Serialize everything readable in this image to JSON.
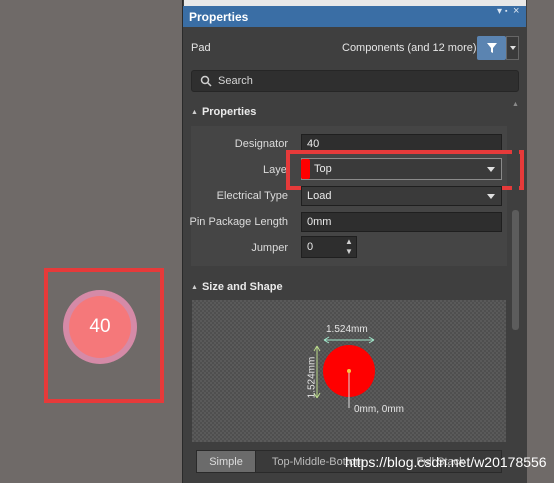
{
  "canvas": {
    "pad_number": "40",
    "pad_outer_color": "#d58aa7",
    "pad_inner_color": "#f5787a",
    "highlight_color": "#e63a3a"
  },
  "panel": {
    "title": "Properties",
    "title_buttons": [
      "▾",
      "▪",
      "×"
    ],
    "accent_color": "#3a6ea5",
    "object_type": "Pad",
    "filter_text": "Components (and 12 more)",
    "filter_icon": "funnel-icon",
    "search": {
      "placeholder": "Search",
      "icon": "search-icon"
    }
  },
  "properties_section": {
    "title": "Properties",
    "rows": [
      {
        "label": "Designator",
        "value": "40"
      },
      {
        "label": "Layer",
        "value": "Top",
        "swatch_color": "#ff0000"
      },
      {
        "label": "Electrical Type",
        "value": "Load"
      },
      {
        "label": "Pin Package Length",
        "value": "0mm"
      },
      {
        "label": "Jumper",
        "value": "0"
      }
    ]
  },
  "size_shape_section": {
    "title": "Size and Shape",
    "width_label": "1.524mm",
    "height_label": "1.524mm",
    "origin_label": "0mm, 0mm",
    "pad_color": "#ff0000",
    "tabs": [
      "Simple",
      "Top-Middle-Bottom",
      "Full Stack"
    ],
    "active_tab": "Simple"
  },
  "watermark": "https://blog.csdn.net/w20178556"
}
